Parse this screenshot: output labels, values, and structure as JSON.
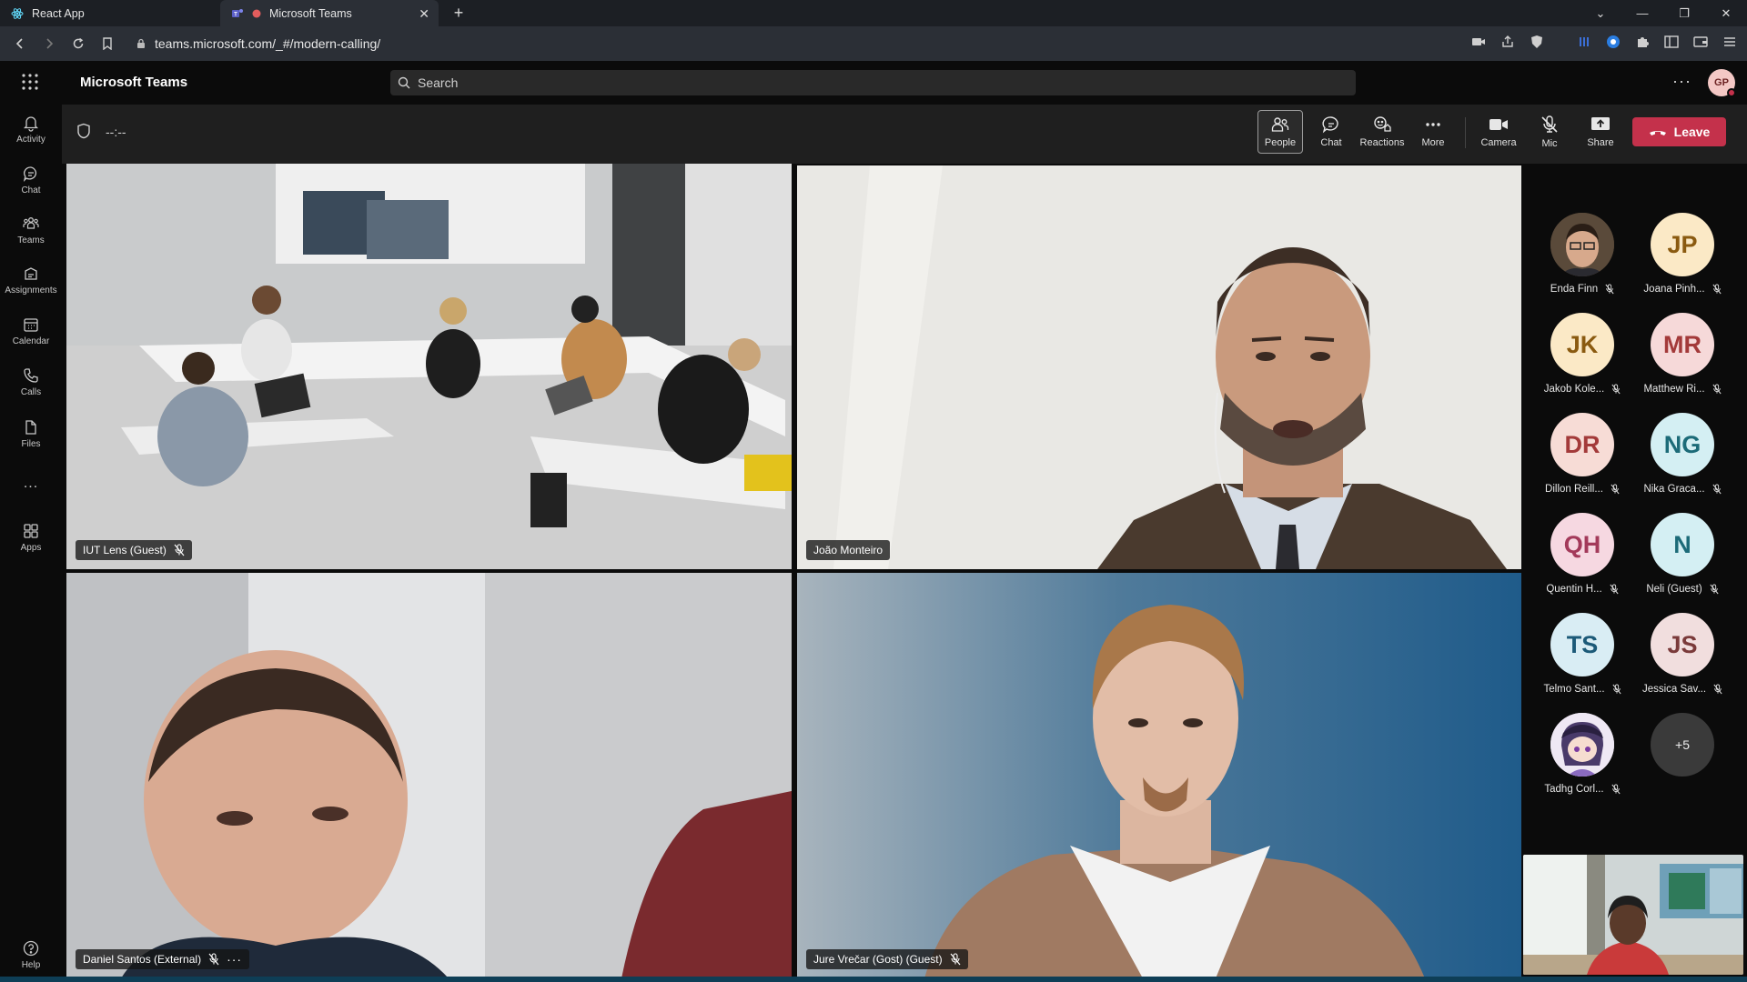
{
  "browser": {
    "tabs": [
      {
        "title": "React App"
      },
      {
        "title": "Microsoft Teams"
      }
    ],
    "url": "teams.microsoft.com/_#/modern-calling/"
  },
  "header": {
    "app_title": "Microsoft Teams",
    "search_placeholder": "Search",
    "user_initials": "GP"
  },
  "rail": [
    {
      "label": "Activity",
      "icon": "bell-icon"
    },
    {
      "label": "Chat",
      "icon": "chat-icon"
    },
    {
      "label": "Teams",
      "icon": "teams-icon"
    },
    {
      "label": "Assignments",
      "icon": "assignments-icon"
    },
    {
      "label": "Calendar",
      "icon": "calendar-icon"
    },
    {
      "label": "Calls",
      "icon": "phone-icon"
    },
    {
      "label": "Files",
      "icon": "file-icon"
    },
    {
      "label": "...",
      "icon": "more-icon"
    },
    {
      "label": "Apps",
      "icon": "apps-icon"
    },
    {
      "label": "Help",
      "icon": "help-icon"
    }
  ],
  "meeting": {
    "timer": "--:--",
    "toolbar": {
      "people": "People",
      "chat": "Chat",
      "reactions": "Reactions",
      "more": "More",
      "camera": "Camera",
      "mic": "Mic",
      "share": "Share",
      "leave": "Leave"
    },
    "tiles": [
      {
        "name": "IUT Lens (Guest)"
      },
      {
        "name": "João Monteiro"
      },
      {
        "name": "Daniel Santos (External)"
      },
      {
        "name": "Jure Vrečar (Gost) (Guest)"
      }
    ]
  },
  "roster": [
    {
      "name": "Enda Finn",
      "initials": "",
      "bg": "#5a4a3a",
      "fg": "#ffffff"
    },
    {
      "name": "Joana Pinh...",
      "initials": "JP",
      "bg": "#fbe9c6",
      "fg": "#8a5a10"
    },
    {
      "name": "Jakob Kole...",
      "initials": "JK",
      "bg": "#fbe9c6",
      "fg": "#8a5a10"
    },
    {
      "name": "Matthew Ri...",
      "initials": "MR",
      "bg": "#f6d9d9",
      "fg": "#a33a3a"
    },
    {
      "name": "Dillon Reill...",
      "initials": "DR",
      "bg": "#f7dcd6",
      "fg": "#a33a3a"
    },
    {
      "name": "Nika Graca...",
      "initials": "NG",
      "bg": "#d4eff3",
      "fg": "#1c6b78"
    },
    {
      "name": "Quentin H...",
      "initials": "QH",
      "bg": "#f6d8e1",
      "fg": "#a33a5a"
    },
    {
      "name": "Neli (Guest)",
      "initials": "N",
      "bg": "#d4eff3",
      "fg": "#1c6b78"
    },
    {
      "name": "Telmo Sant...",
      "initials": "TS",
      "bg": "#d9edf4",
      "fg": "#1c5a78"
    },
    {
      "name": "Jessica Sav...",
      "initials": "JS",
      "bg": "#f1dede",
      "fg": "#7a3a3a"
    },
    {
      "name": "Tadhg Corl...",
      "initials": "",
      "bg": "#e6dcef",
      "fg": "#5a3a7a"
    }
  ],
  "roster_overflow": "+5",
  "colors": {
    "accent": "#7f85f5",
    "leave": "#c4314b"
  }
}
